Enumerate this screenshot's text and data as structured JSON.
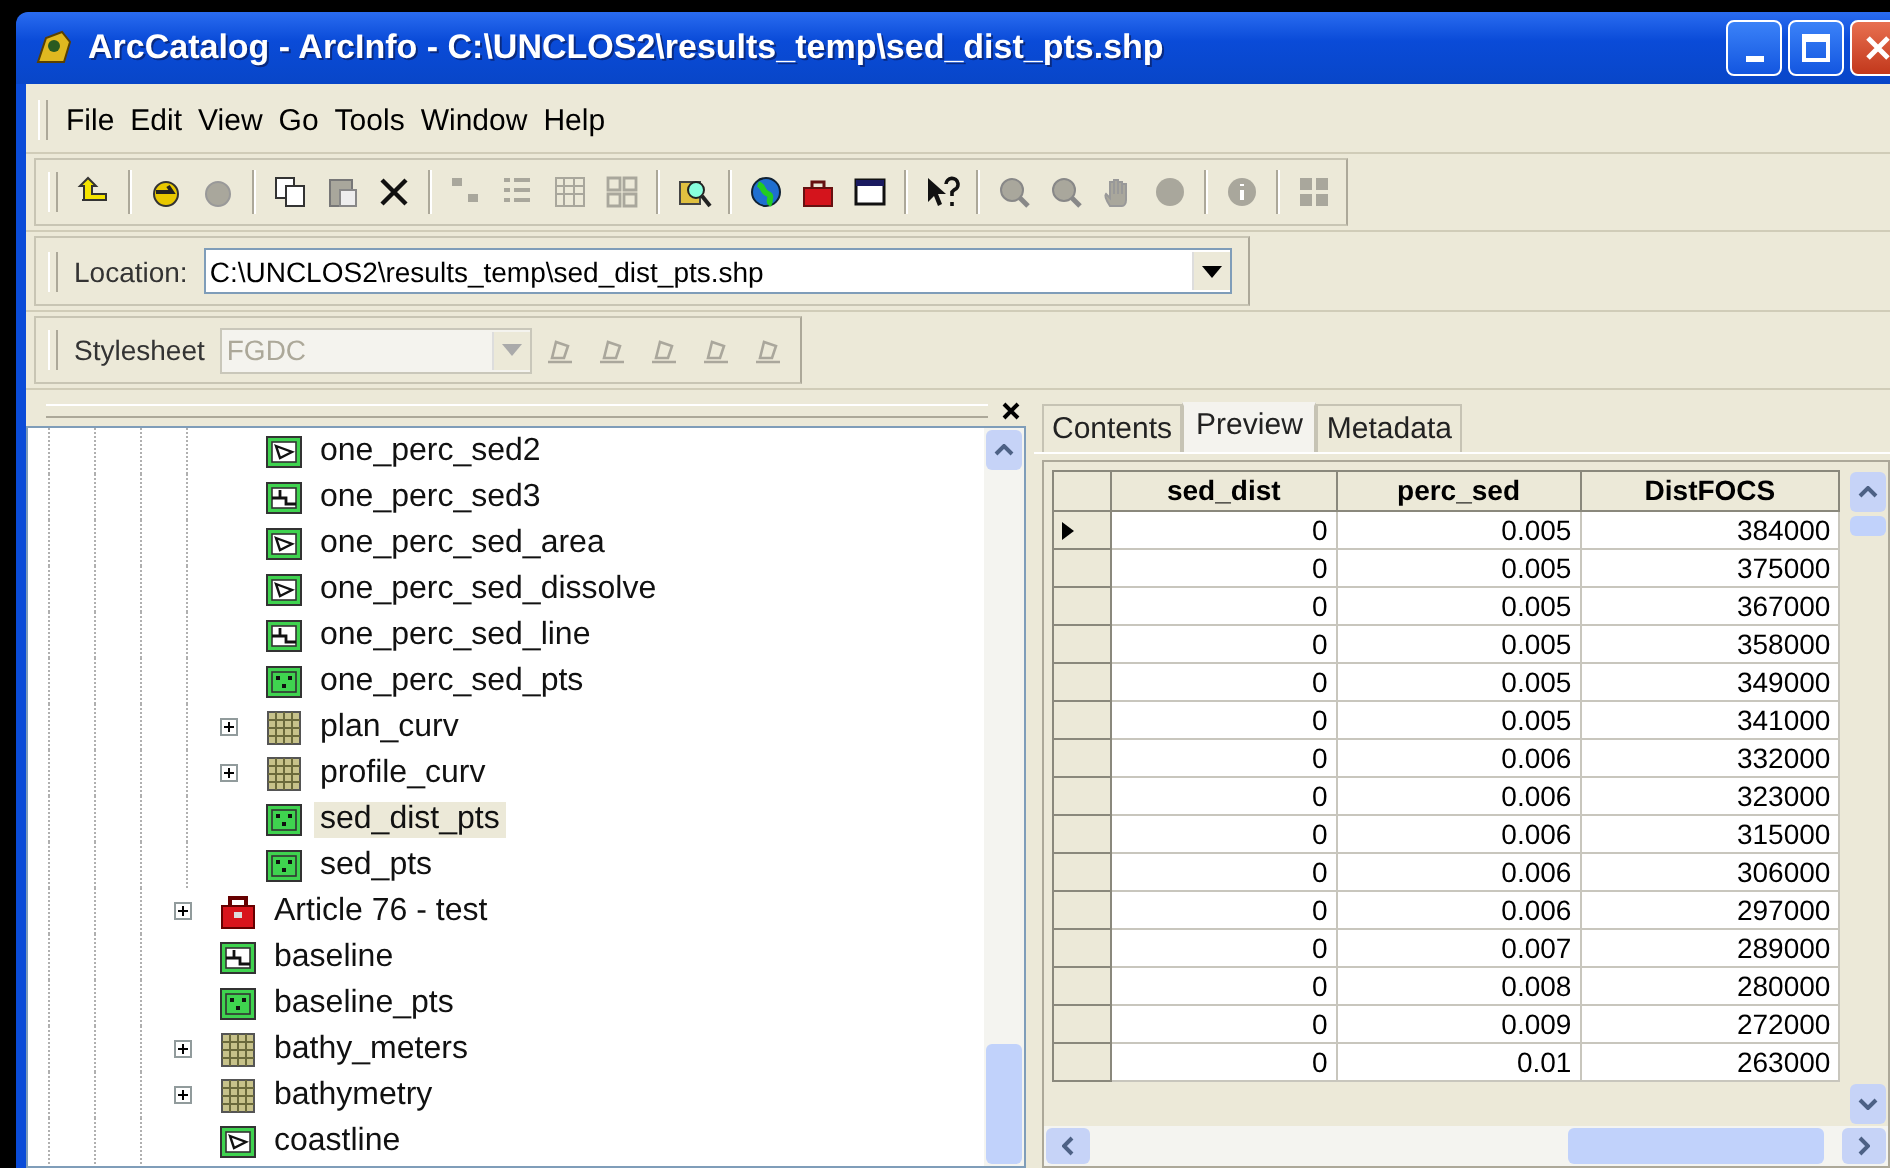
{
  "window": {
    "title": "ArcCatalog - ArcInfo - C:\\UNCLOS2\\results_temp\\sed_dist_pts.shp"
  },
  "menu": [
    "File",
    "Edit",
    "View",
    "Go",
    "Tools",
    "Window",
    "Help"
  ],
  "toolbar": [
    [
      {
        "kind": "up",
        "disabled": false
      }
    ],
    [
      {
        "kind": "connect",
        "disabled": false
      },
      {
        "kind": "disconnect",
        "disabled": true
      }
    ],
    [
      {
        "kind": "copy",
        "disabled": false
      },
      {
        "kind": "paste",
        "disabled": true
      },
      {
        "kind": "delete",
        "disabled": false
      }
    ],
    [
      {
        "kind": "large-icons",
        "disabled": true
      },
      {
        "kind": "list",
        "disabled": true
      },
      {
        "kind": "details",
        "disabled": true
      },
      {
        "kind": "thumbnails",
        "disabled": true
      }
    ],
    [
      {
        "kind": "search",
        "disabled": false
      }
    ],
    [
      {
        "kind": "globe",
        "disabled": false
      },
      {
        "kind": "toolbox",
        "disabled": false
      },
      {
        "kind": "command",
        "disabled": false
      }
    ],
    [
      {
        "kind": "whats-this",
        "disabled": false
      }
    ],
    [
      {
        "kind": "zoom-in",
        "disabled": true
      },
      {
        "kind": "zoom-out",
        "disabled": true
      },
      {
        "kind": "pan",
        "disabled": true
      },
      {
        "kind": "full-extent",
        "disabled": true
      }
    ],
    [
      {
        "kind": "identify",
        "disabled": true
      }
    ],
    [
      {
        "kind": "thumbnail",
        "disabled": true
      }
    ]
  ],
  "location": {
    "label": "Location:",
    "value": "C:\\UNCLOS2\\results_temp\\sed_dist_pts.shp"
  },
  "stylesheet": {
    "label": "Stylesheet",
    "value": "FGDC",
    "disabled": true,
    "tools": [
      {
        "disabled": true
      },
      {
        "disabled": true
      },
      {
        "disabled": true
      },
      {
        "disabled": true
      },
      {
        "disabled": true
      }
    ]
  },
  "tree": {
    "continued_children": [
      {
        "label": "one_perc_sed2",
        "kind": "polygon",
        "expandable": false,
        "selected": false
      },
      {
        "label": "one_perc_sed3",
        "kind": "line",
        "expandable": false,
        "selected": false
      },
      {
        "label": "one_perc_sed_area",
        "kind": "polygon",
        "expandable": false,
        "selected": false
      },
      {
        "label": "one_perc_sed_dissolve",
        "kind": "polygon",
        "expandable": false,
        "selected": false
      },
      {
        "label": "one_perc_sed_line",
        "kind": "line",
        "expandable": false,
        "selected": false
      },
      {
        "label": "one_perc_sed_pts",
        "kind": "point",
        "expandable": false,
        "selected": false
      },
      {
        "label": "plan_curv",
        "kind": "raster",
        "expandable": true,
        "selected": false
      },
      {
        "label": "profile_curv",
        "kind": "raster",
        "expandable": true,
        "selected": false
      },
      {
        "label": "sed_dist_pts",
        "kind": "point",
        "expandable": false,
        "selected": true
      },
      {
        "label": "sed_pts",
        "kind": "point",
        "expandable": false,
        "selected": false
      }
    ],
    "items": [
      {
        "label": "Article 76 - test",
        "kind": "toolbox",
        "expandable": true,
        "selected": false
      },
      {
        "label": "baseline",
        "kind": "line",
        "expandable": false,
        "selected": false
      },
      {
        "label": "baseline_pts",
        "kind": "point",
        "expandable": false,
        "selected": false
      },
      {
        "label": "bathy_meters",
        "kind": "raster",
        "expandable": true,
        "selected": false
      },
      {
        "label": "bathymetry",
        "kind": "raster",
        "expandable": true,
        "selected": false
      },
      {
        "label": "coastline",
        "kind": "polygon",
        "expandable": false,
        "selected": false
      }
    ]
  },
  "tabs": [
    {
      "label": "Contents",
      "selected": false
    },
    {
      "label": "Preview",
      "selected": true
    },
    {
      "label": "Metadata",
      "selected": false
    }
  ],
  "table": {
    "columns": [
      "sed_dist",
      "perc_sed",
      "DistFOCS"
    ],
    "rows": [
      {
        "current": true,
        "cells": [
          "0",
          "0.005",
          "384000"
        ]
      },
      {
        "current": false,
        "cells": [
          "0",
          "0.005",
          "375000"
        ]
      },
      {
        "current": false,
        "cells": [
          "0",
          "0.005",
          "367000"
        ]
      },
      {
        "current": false,
        "cells": [
          "0",
          "0.005",
          "358000"
        ]
      },
      {
        "current": false,
        "cells": [
          "0",
          "0.005",
          "349000"
        ]
      },
      {
        "current": false,
        "cells": [
          "0",
          "0.005",
          "341000"
        ]
      },
      {
        "current": false,
        "cells": [
          "0",
          "0.006",
          "332000"
        ]
      },
      {
        "current": false,
        "cells": [
          "0",
          "0.006",
          "323000"
        ]
      },
      {
        "current": false,
        "cells": [
          "0",
          "0.006",
          "315000"
        ]
      },
      {
        "current": false,
        "cells": [
          "0",
          "0.006",
          "306000"
        ]
      },
      {
        "current": false,
        "cells": [
          "0",
          "0.006",
          "297000"
        ]
      },
      {
        "current": false,
        "cells": [
          "0",
          "0.007",
          "289000"
        ]
      },
      {
        "current": false,
        "cells": [
          "0",
          "0.008",
          "280000"
        ]
      },
      {
        "current": false,
        "cells": [
          "0",
          "0.009",
          "272000"
        ]
      },
      {
        "current": false,
        "cells": [
          "0",
          "0.01",
          "263000"
        ]
      }
    ]
  }
}
